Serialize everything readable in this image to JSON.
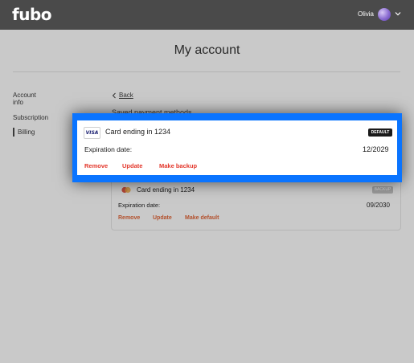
{
  "header": {
    "logo": "fubo",
    "user_name": "Olivia"
  },
  "page": {
    "title": "My account"
  },
  "sidebar": {
    "items": [
      {
        "label": "Account info"
      },
      {
        "label": "Subscription"
      },
      {
        "label": "Billing",
        "active": true
      }
    ]
  },
  "main": {
    "back_label": "Back",
    "section_title": "Saved payment methods",
    "default_card": {
      "brand_icon": "visa-icon",
      "brand_text": "VISA",
      "label": "Card ending in 1234",
      "badge": "DEFAULT",
      "expiration_label": "Expiration date:",
      "expiration_value": "12/2029",
      "actions": [
        "Remove",
        "Update",
        "Make backup"
      ]
    },
    "backup_card": {
      "brand_icon": "mastercard-icon",
      "label": "Card ending in 1234",
      "badge": "BACKUP",
      "expiration_label": "Expiration date:",
      "expiration_value": "09/2030",
      "actions": [
        "Remove",
        "Update",
        "Make default"
      ]
    }
  },
  "colors": {
    "highlight": "#0a74ff",
    "action_red": "#e3362a",
    "topbar": "#4a4a4a",
    "overlay_bg": "#c9c9c9"
  }
}
